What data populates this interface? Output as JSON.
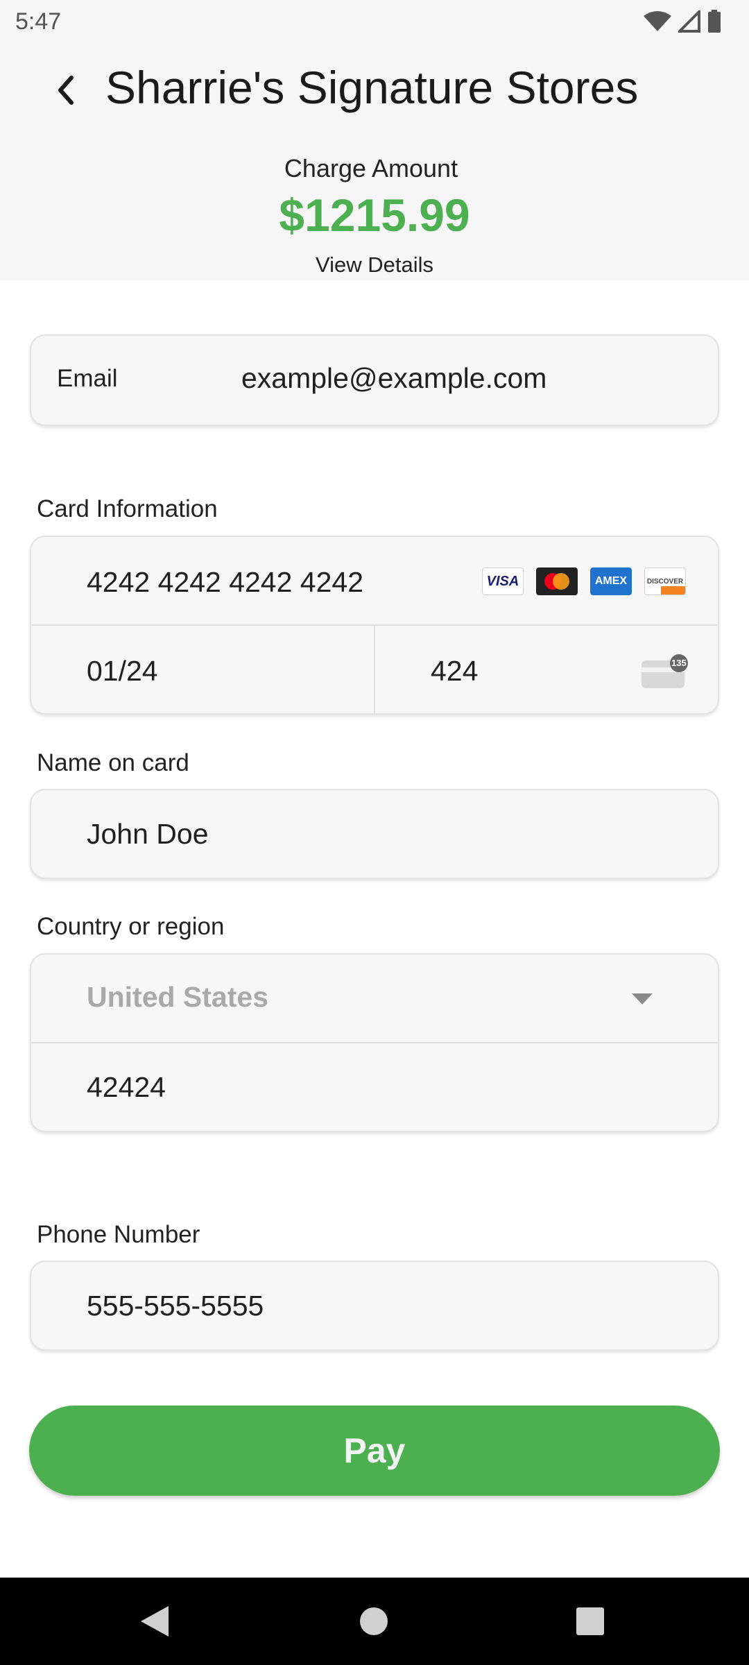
{
  "status": {
    "time": "5:47"
  },
  "header": {
    "title": "Sharrie's Signature Stores",
    "charge_label": "Charge Amount",
    "charge_amount": "$1215.99",
    "view_details": "View Details"
  },
  "email": {
    "label": "Email",
    "value": "example@example.com"
  },
  "card": {
    "section_label": "Card Information",
    "number": "4242 4242 4242 4242",
    "expiry": "01/24",
    "cvc": "424",
    "brands": [
      "VISA",
      "mastercard",
      "AMEX",
      "DISCOVER"
    ],
    "cvc_badge": "135"
  },
  "name": {
    "label": "Name on card",
    "value": "John Doe"
  },
  "country": {
    "label": "Country or region",
    "selected": "United States",
    "postal": "42424"
  },
  "phone": {
    "label": "Phone Number",
    "value": "555-555-5555"
  },
  "pay": {
    "label": "Pay"
  },
  "colors": {
    "accent": "#4caf50",
    "background": "#f6f6f6"
  },
  "icons": {
    "back": "chevron-left-icon",
    "dropdown": "caret-down-icon",
    "cvc": "card-back-icon"
  }
}
